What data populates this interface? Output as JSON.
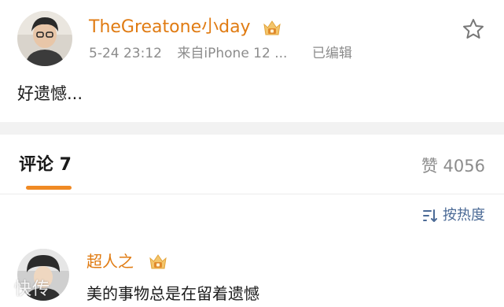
{
  "post": {
    "username": "TheGreatone小day",
    "date": "5-24 23:12",
    "source": "来自iPhone 12 ...",
    "edited": "已编辑",
    "text": "好遗憾..."
  },
  "tabs": {
    "comments": "评论 7",
    "likes": "赞 4056"
  },
  "sort": {
    "label": "按热度"
  },
  "comment": {
    "author": "超人之",
    "text": "美的事物总是在留着遗憾"
  },
  "watermark": {
    "text": "快传"
  },
  "icons": {
    "post_avatar": "avatar-photo",
    "vip": "vip-crown-badge",
    "favorite": "star-outline-icon",
    "sort": "sort-lines-icon"
  },
  "colors": {
    "username": "#e07b12",
    "meta": "#8c8c8c",
    "accent_underline": "#f08a24",
    "link_blue": "#4b6a96",
    "band": "#f2f2f2"
  }
}
